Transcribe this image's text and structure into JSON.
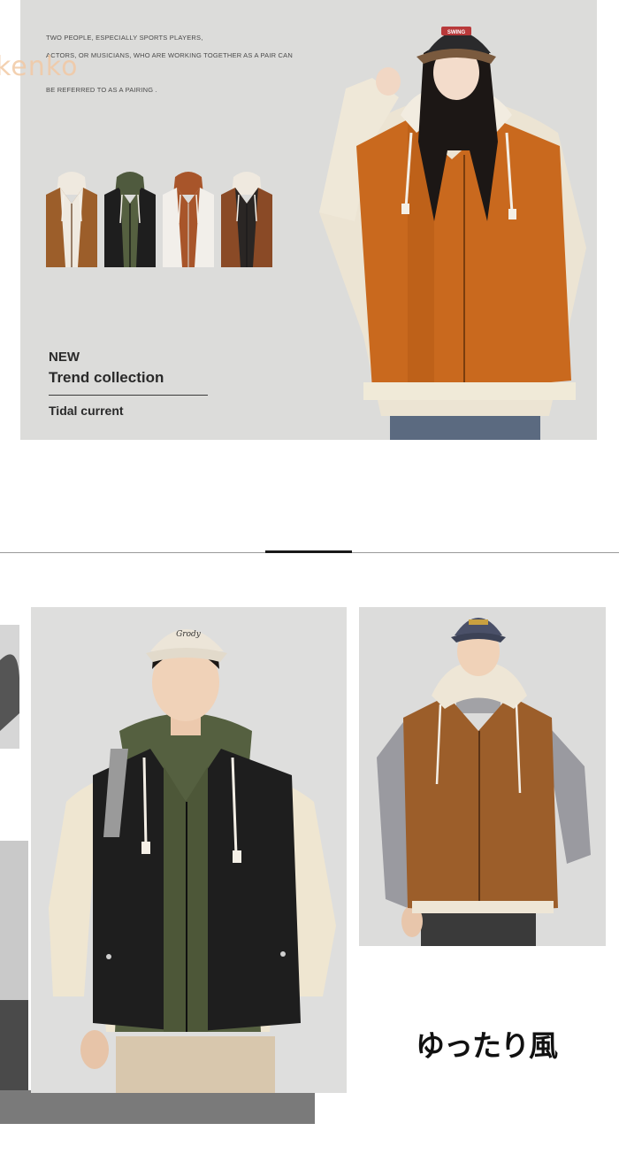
{
  "banner": {
    "brand": "kenko",
    "tagline_lines": [
      "TWO PEOPLE, ESPECIALLY SPORTS PLAYERS,",
      "ACTORS, OR MUSICIANS, WHO ARE WORKING TOGETHER AS A PAIR CAN",
      "BE REFERRED TO AS A PAIRING ."
    ],
    "new_label": "NEW",
    "collection_title": "Trend collection",
    "subtitle": "Tidal current",
    "cap_text": "SWING"
  },
  "second_section": {
    "cap_text": "Grody",
    "caption": "ゆったり風"
  },
  "colors": {
    "banner_bg": "#dcdcda",
    "brand": "#f2c9a4",
    "orange_vest": "#c9691e",
    "brown_vest": "#9c5e2a",
    "black_vest": "#1e1e1e",
    "olive": "#556040",
    "cream": "#eee6d6"
  },
  "icons": [
    "drawstring-hoodie",
    "zipper",
    "baseball-cap"
  ]
}
